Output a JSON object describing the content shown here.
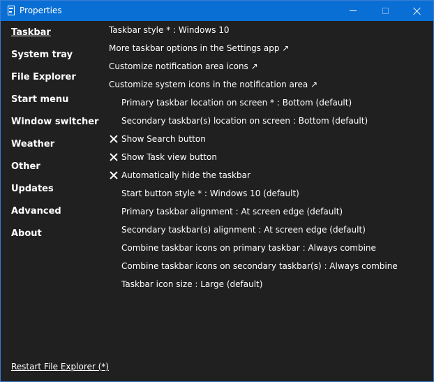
{
  "window": {
    "title": "Properties"
  },
  "sidebar": {
    "items": [
      {
        "label": "Taskbar",
        "active": true
      },
      {
        "label": "System tray"
      },
      {
        "label": "File Explorer"
      },
      {
        "label": "Start menu"
      },
      {
        "label": "Window switcher"
      },
      {
        "label": "Weather"
      },
      {
        "label": "Other"
      },
      {
        "label": "Updates"
      },
      {
        "label": "Advanced"
      },
      {
        "label": "About"
      }
    ],
    "restart_label": "Restart File Explorer (*)"
  },
  "options": [
    {
      "text": "Taskbar style * : Windows 10",
      "indent": 0
    },
    {
      "text": "More taskbar options in the Settings app ↗",
      "indent": 0
    },
    {
      "text": "Customize notification area icons ↗",
      "indent": 0
    },
    {
      "text": "Customize system icons in the notification area ↗",
      "indent": 0
    },
    {
      "text": "Primary taskbar location on screen * : Bottom (default)",
      "indent": 1
    },
    {
      "text": "Secondary taskbar(s) location on screen : Bottom (default)",
      "indent": 1
    },
    {
      "text": "Show Search button",
      "indent": 1,
      "checked": true
    },
    {
      "text": "Show Task view button",
      "indent": 1,
      "checked": true
    },
    {
      "text": "Automatically hide the taskbar",
      "indent": 1,
      "checked": true
    },
    {
      "text": "Start button style * : Windows 10 (default)",
      "indent": 1
    },
    {
      "text": "Primary taskbar alignment : At screen edge (default)",
      "indent": 1
    },
    {
      "text": "Secondary taskbar(s) alignment : At screen edge (default)",
      "indent": 1
    },
    {
      "text": "Combine taskbar icons on primary taskbar : Always combine",
      "indent": 1
    },
    {
      "text": "Combine taskbar icons on secondary taskbar(s) : Always combine",
      "indent": 1
    },
    {
      "text": "Taskbar icon size : Large (default)",
      "indent": 1
    }
  ],
  "colors": {
    "titlebar": "#0a6fd4",
    "background": "#202020",
    "text": "#ffffff"
  }
}
